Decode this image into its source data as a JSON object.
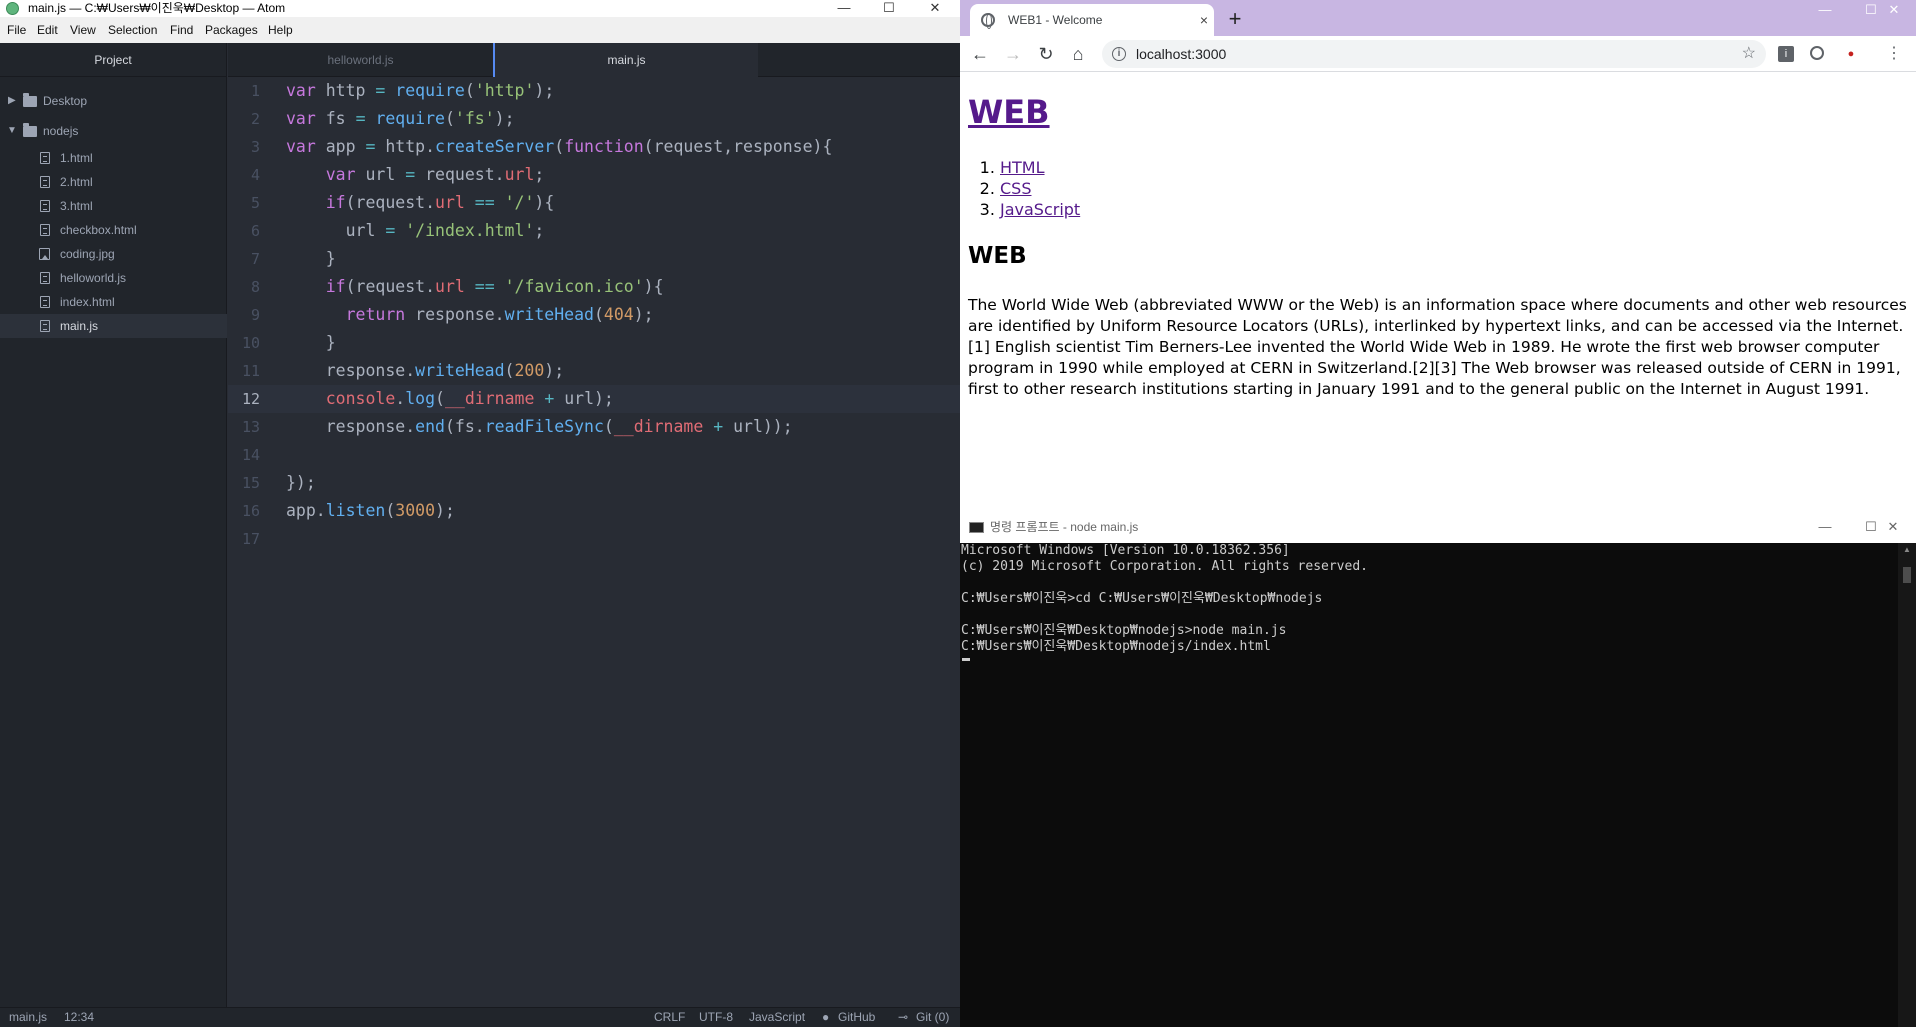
{
  "atom": {
    "title": "main.js — C:₩Users₩이진욱₩Desktop — Atom",
    "window_controls": {
      "minimize": "—",
      "maximize": "☐",
      "close": "✕"
    },
    "menu": [
      "File",
      "Edit",
      "View",
      "Selection",
      "Find",
      "Packages",
      "Help"
    ],
    "tree": {
      "header": "Project",
      "folders": [
        {
          "name": "Desktop",
          "expanded": false
        },
        {
          "name": "nodejs",
          "expanded": true
        }
      ],
      "files": [
        "1.html",
        "2.html",
        "3.html",
        "checkbox.html",
        "coding.jpg",
        "helloworld.js",
        "index.html",
        "main.js"
      ],
      "selected": "main.js"
    },
    "tabs": [
      {
        "label": "helloworld.js",
        "active": false
      },
      {
        "label": "main.js",
        "active": true
      }
    ],
    "code_lines": [
      "var http = require('http');",
      "var fs = require('fs');",
      "var app = http.createServer(function(request,response){",
      "    var url = request.url;",
      "    if(request.url == '/'){",
      "      url = '/index.html';",
      "    }",
      "    if(request.url == '/favicon.ico'){",
      "      return response.writeHead(404);",
      "    }",
      "    response.writeHead(200);",
      "    console.log(__dirname + url);",
      "    response.end(fs.readFileSync(__dirname + url));",
      "",
      "});",
      "app.listen(3000);",
      ""
    ],
    "line_numbers": [
      "1",
      "2",
      "3",
      "4",
      "5",
      "6",
      "7",
      "8",
      "9",
      "10",
      "11",
      "12",
      "13",
      "14",
      "15",
      "16",
      "17"
    ],
    "cursor_line": 12,
    "status": {
      "file": "main.js",
      "position": "12:34",
      "line_ending": "CRLF",
      "encoding": "UTF-8",
      "grammar": "JavaScript",
      "github": "GitHub",
      "git": "Git (0)"
    }
  },
  "browser": {
    "tab_title": "WEB1 - Welcome",
    "tab_close": "×",
    "new_tab": "+",
    "url": "localhost:3000",
    "page": {
      "h1": "WEB",
      "links": [
        "HTML",
        "CSS",
        "JavaScript"
      ],
      "h2": "WEB",
      "paragraph": "The World Wide Web (abbreviated WWW or the Web) is an information space where documents and other web resources are identified by Uniform Resource Locators (URLs), interlinked by hypertext links, and can be accessed via the Internet.[1] English scientist Tim Berners-Lee invented the World Wide Web in 1989. He wrote the first web browser computer program in 1990 while employed at CERN in Switzerland.[2][3] The Web browser was released outside of CERN in 1991, first to other research institutions starting in January 1991 and to the general public on the Internet in August 1991."
    }
  },
  "cmd": {
    "title": "명령 프롬프트 - node  main.js",
    "lines": [
      "Microsoft Windows [Version 10.0.18362.356]",
      "(c) 2019 Microsoft Corporation. All rights reserved.",
      "",
      "C:₩Users₩이진욱>cd C:₩Users₩이진욱₩Desktop₩nodejs",
      "",
      "C:₩Users₩이진욱₩Desktop₩nodejs>node main.js",
      "C:₩Users₩이진욱₩Desktop₩nodejs/index.html"
    ]
  },
  "colors": {
    "atom_bg": "#282c34",
    "atom_tree_bg": "#21252b",
    "chrome_tabstrip": "#c8b6e2",
    "link_visited": "#551a8b",
    "console_bg": "#0c0c0c"
  }
}
